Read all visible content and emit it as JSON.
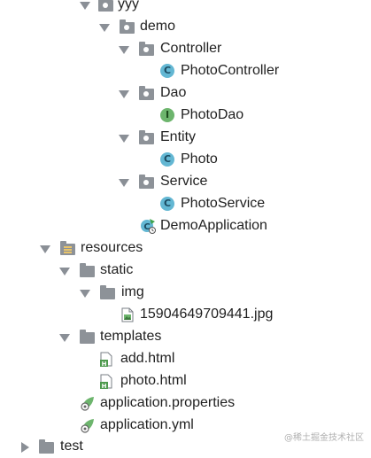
{
  "tree": {
    "yyy": "yyy",
    "demo": "demo",
    "controller": "Controller",
    "photo_controller": "PhotoController",
    "dao": "Dao",
    "photo_dao": "PhotoDao",
    "entity": "Entity",
    "photo": "Photo",
    "service": "Service",
    "photo_service": "PhotoService",
    "demo_application": "DemoApplication",
    "resources": "resources",
    "static": "static",
    "img": "img",
    "image_file": "15904649709441.jpg",
    "templates": "templates",
    "add_html": "add.html",
    "photo_html": "photo.html",
    "application_properties": "application.properties",
    "application_yml": "application.yml",
    "test": "test"
  },
  "badges": {
    "class_letter": "C",
    "interface_letter": "I"
  },
  "colors": {
    "class_badge": "#63b7d3",
    "interface_badge": "#6db56d",
    "folder": "#8d9298",
    "arrow": "#8a8f96"
  },
  "watermark": "@稀土掘金技术社区"
}
